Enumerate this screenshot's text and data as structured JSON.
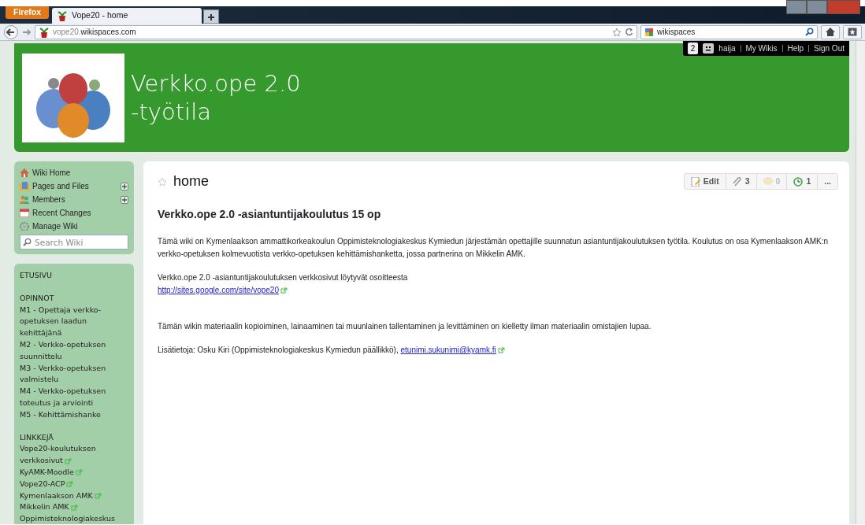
{
  "browser": {
    "menu_button": "Firefox",
    "tabs": [
      {
        "title": "Vope20 - home",
        "selected": true
      }
    ],
    "url_subdomain": "vope20.",
    "url_domain": "wikispaces.com",
    "search_value": "wikispaces"
  },
  "user_bar": {
    "notification_count": "2",
    "username": "haija",
    "links": [
      "My Wikis",
      "Help",
      "Sign Out"
    ]
  },
  "header": {
    "title_lines": [
      "Verkko.ope 2.0",
      "-työtila"
    ]
  },
  "sidebar": {
    "nav_items": [
      {
        "kind": "home",
        "label": "Wiki Home",
        "expandable": false
      },
      {
        "kind": "pages",
        "label": "Pages and Files",
        "expandable": true
      },
      {
        "kind": "members",
        "label": "Members",
        "expandable": true
      },
      {
        "kind": "changes",
        "label": "Recent Changes",
        "expandable": false
      },
      {
        "kind": "manage",
        "label": "Manage Wiki",
        "expandable": false
      }
    ],
    "search": {
      "placeholder": "Search Wiki"
    },
    "navigation_groups": [
      {
        "items": [
          {
            "label": "ETUSIVU",
            "external": false
          }
        ]
      },
      {
        "items": [
          {
            "label": "OPINNOT",
            "external": false
          },
          {
            "label": "M1 - Opettaja verkko-opetuksen laadun kehittäjänä",
            "external": false
          },
          {
            "label": "M2 - Verkko-opetuksen suunnittelu",
            "external": false
          },
          {
            "label": "M3 - Verkko-opetuksen valmistelu",
            "external": false
          },
          {
            "label": "M4 - Verkko-opetuksen toteutus ja arviointi",
            "external": false
          },
          {
            "label": "M5 - Kehittämishanke",
            "external": false
          }
        ]
      },
      {
        "items": [
          {
            "label": "LINKKEJÄ",
            "external": false
          },
          {
            "label": "Vope20-koulutuksen verkkosivut",
            "external": true
          },
          {
            "label": "KyAMK-Moodle",
            "external": true
          },
          {
            "label": "Vope20-ACP",
            "external": true
          },
          {
            "label": "Kymenlaakson AMK",
            "external": true
          },
          {
            "label": "Mikkelin AMK",
            "external": true
          },
          {
            "label": "Oppimisteknologiakeskus",
            "external": false
          }
        ]
      }
    ]
  },
  "page": {
    "title": "home",
    "favorite": false,
    "actions": [
      {
        "kind": "edit",
        "label": "Edit",
        "disabled": false
      },
      {
        "kind": "links",
        "label": "3",
        "disabled": false
      },
      {
        "kind": "comments",
        "label": "0",
        "disabled": true
      },
      {
        "kind": "history",
        "label": "1",
        "disabled": false
      },
      {
        "kind": "more",
        "label": "...",
        "disabled": false
      }
    ],
    "heading": "Verkko.ope 2.0 -asiantuntijakoulutus 15 op",
    "paragraphs": [
      {
        "text": "Tämä wiki on Kymenlaakson ammattikorkeakoulun Oppimisteknologiakeskus Kymiedun järjestämän opettajille suunnatun asiantuntijakoulutuksen työtila. Koulutus on osa Kymenlaakson AMK:n verkko-opetuksen kolmevuotista verkko-opetuksen kehittämishanketta, jossa partnerina on Mikkelin AMK."
      },
      {
        "text": "Verkko.ope 2.0 -asiantuntijakoulutuksen verkkosivut löytyvät osoitteesta",
        "link": "http://sites.google.com/site/vope20",
        "link_break": true
      },
      {
        "text": "Tämän wikin materiaalin kopioiminen, lainaaminen tai muunlainen tallentaminen ja levittäminen on kielletty ilman materiaalin omistajien lupaa."
      },
      {
        "text": "Lisätietoja: Osku Kiri (Oppimisteknologiakeskus Kymiedun päällikkö),",
        "link": "etunimi.sukunimi@kyamk.fi",
        "link_break": false
      }
    ]
  }
}
